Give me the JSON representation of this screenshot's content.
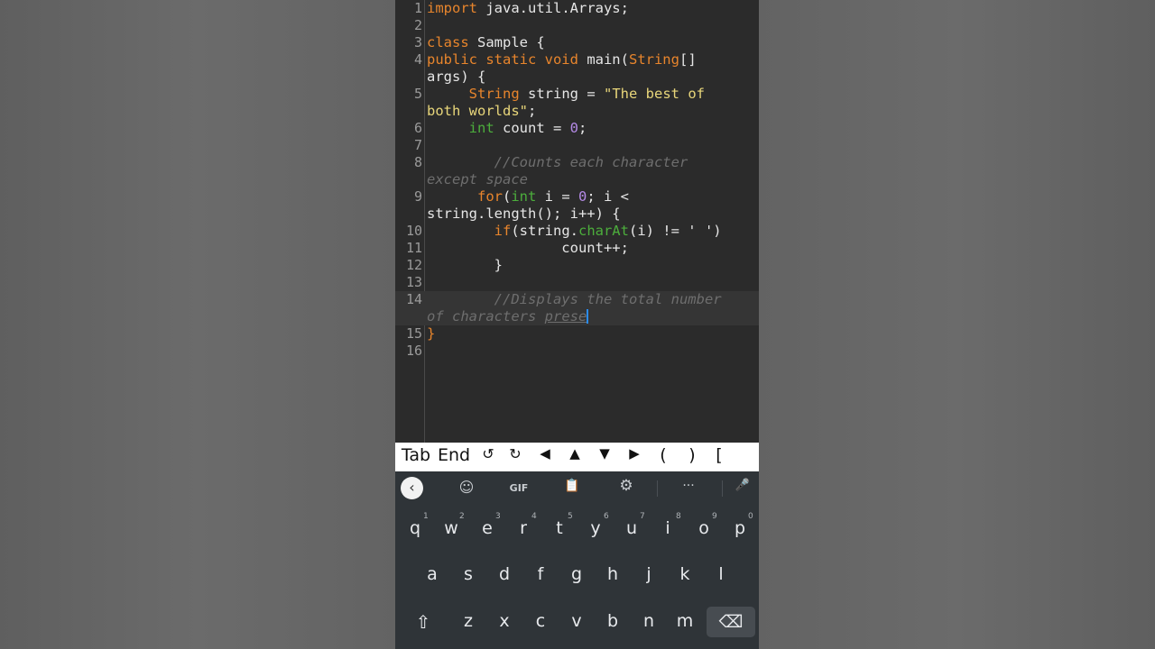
{
  "editor": {
    "lines": [
      {
        "n": "1",
        "parts": [
          {
            "t": "import",
            "c": "kw"
          },
          {
            "t": " java.util.Arrays;"
          }
        ]
      },
      {
        "n": "2",
        "parts": []
      },
      {
        "n": "3",
        "parts": [
          {
            "t": "class",
            "c": "kw"
          },
          {
            "t": " Sample {"
          }
        ]
      },
      {
        "n": "4",
        "parts": [
          {
            "t": "public static void",
            "c": "kw"
          },
          {
            "t": " main("
          },
          {
            "t": "String",
            "c": "kw"
          },
          {
            "t": "[]"
          }
        ]
      },
      {
        "n": "",
        "parts": [
          {
            "t": "args) {"
          }
        ]
      },
      {
        "n": "5",
        "parts": [
          {
            "t": "     "
          },
          {
            "t": "String",
            "c": "kw"
          },
          {
            "t": " string = "
          },
          {
            "t": "\"The best of",
            "c": "st"
          }
        ]
      },
      {
        "n": "",
        "parts": [
          {
            "t": "both worlds\"",
            "c": "st"
          },
          {
            "t": ";"
          }
        ]
      },
      {
        "n": "6",
        "parts": [
          {
            "t": "     "
          },
          {
            "t": "int",
            "c": "ty"
          },
          {
            "t": " count = "
          },
          {
            "t": "0",
            "c": "nm"
          },
          {
            "t": ";"
          }
        ]
      },
      {
        "n": "7",
        "parts": []
      },
      {
        "n": "8",
        "parts": [
          {
            "t": "        "
          },
          {
            "t": "//Counts each character",
            "c": "cm"
          }
        ]
      },
      {
        "n": "",
        "parts": [
          {
            "t": "except space",
            "c": "cm"
          }
        ]
      },
      {
        "n": "9",
        "parts": [
          {
            "t": "      "
          },
          {
            "t": "for",
            "c": "kw"
          },
          {
            "t": "("
          },
          {
            "t": "int",
            "c": "ty"
          },
          {
            "t": " i = "
          },
          {
            "t": "0",
            "c": "nm"
          },
          {
            "t": "; i <"
          }
        ]
      },
      {
        "n": "",
        "parts": [
          {
            "t": "string.length(); i++) {"
          }
        ]
      },
      {
        "n": "10",
        "parts": [
          {
            "t": "        "
          },
          {
            "t": "if",
            "c": "kw"
          },
          {
            "t": "(string."
          },
          {
            "t": "charAt",
            "c": "mt"
          },
          {
            "t": "(i) != ' ')"
          }
        ]
      },
      {
        "n": "11",
        "parts": [
          {
            "t": "                count++;"
          }
        ]
      },
      {
        "n": "12",
        "parts": [
          {
            "t": "        }"
          }
        ]
      },
      {
        "n": "13",
        "parts": []
      },
      {
        "n": "14",
        "parts": [
          {
            "t": "        "
          },
          {
            "t": "//Displays the total number",
            "c": "cm"
          }
        ],
        "hl": true
      },
      {
        "n": "",
        "parts": [
          {
            "t": "of characters ",
            "c": "cm"
          },
          {
            "t": "prese",
            "c": "cm ul"
          }
        ],
        "hl": true,
        "cursor": true
      },
      {
        "n": "15",
        "parts": [
          {
            "t": "}",
            "c": "kw"
          }
        ]
      },
      {
        "n": "16",
        "parts": []
      }
    ]
  },
  "keybar": {
    "keys": [
      "Tab",
      "End",
      "↺",
      "↻",
      "◀",
      "▲",
      "▼",
      "▶",
      "(",
      ")",
      "["
    ]
  },
  "keyboard": {
    "toolbar": {
      "back": "‹",
      "sticker": "☺",
      "gif": "GIF",
      "clipboard": "📋",
      "settings": "⚙",
      "more": "···",
      "mic": "🎤"
    },
    "row1": [
      {
        "k": "q",
        "h": "1"
      },
      {
        "k": "w",
        "h": "2"
      },
      {
        "k": "e",
        "h": "3"
      },
      {
        "k": "r",
        "h": "4"
      },
      {
        "k": "t",
        "h": "5"
      },
      {
        "k": "y",
        "h": "6"
      },
      {
        "k": "u",
        "h": "7"
      },
      {
        "k": "i",
        "h": "8"
      },
      {
        "k": "o",
        "h": "9"
      },
      {
        "k": "p",
        "h": "0"
      }
    ],
    "row2": [
      "a",
      "s",
      "d",
      "f",
      "g",
      "h",
      "j",
      "k",
      "l"
    ],
    "row3": [
      "z",
      "x",
      "c",
      "v",
      "b",
      "n",
      "m"
    ],
    "shift": "⇧",
    "backspace": "⌫"
  }
}
